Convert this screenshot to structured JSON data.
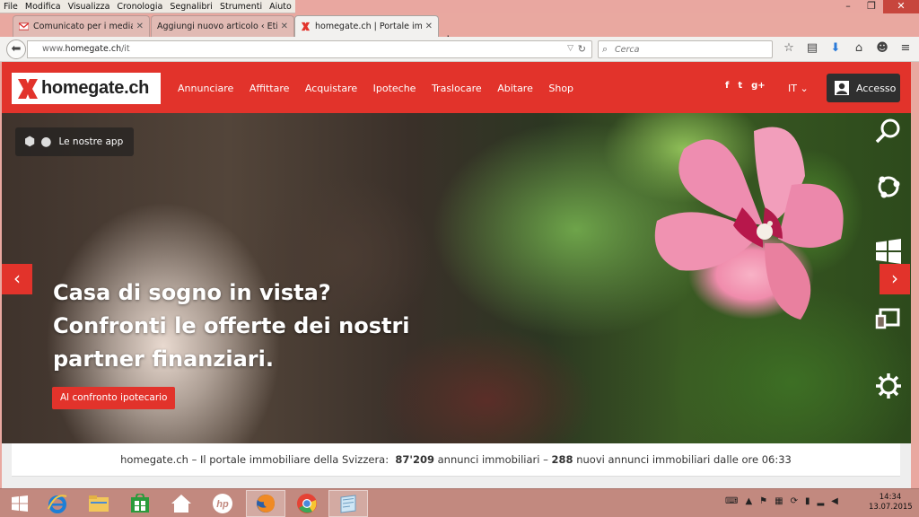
{
  "menubar": {
    "items": [
      "File",
      "Modifica",
      "Visualizza",
      "Cronologia",
      "Segnalibri",
      "Strumenti",
      "Aiuto"
    ]
  },
  "window_controls": {
    "minimize": "–",
    "restore": "❐",
    "close": "✕"
  },
  "tabs": [
    {
      "label": "Comunicato per i media: Il ...",
      "icon": "gmail-icon"
    },
    {
      "label": "Aggiungi nuovo articolo ‹ Etici...",
      "icon": "wordpress-icon"
    },
    {
      "label": "homegate.ch | Portale im...",
      "icon": "homegate-icon",
      "active": true
    }
  ],
  "new_tab": "+",
  "address_bar": {
    "prefix": "www.",
    "host": "homegate.ch",
    "path": "/it"
  },
  "search_bar": {
    "placeholder": "Cerca"
  },
  "site": {
    "logo_text": "homegate.ch",
    "nav": [
      "Annunciare",
      "Affittare",
      "Acquistare",
      "Ipoteche",
      "Traslocare",
      "Abitare",
      "Shop"
    ],
    "social": [
      "f",
      "t",
      "g+"
    ],
    "language": "IT",
    "login_label": "Accesso",
    "apps_label": "Le nostre app",
    "headline": [
      "Casa di sogno in vista?",
      "Confronti le offerte dei nostri",
      "partner finanziari."
    ],
    "cta_label": "Al confronto ipotecario",
    "info": {
      "prefix": "homegate.ch – Il portale immobiliare della Svizzera:",
      "count_total": "87'209",
      "mid": "annunci immobiliari –",
      "count_new": "288",
      "suffix": "nuovi annunci immobiliari dalle ore 06:33"
    },
    "brand_color": "#e2332b"
  },
  "taskbar": {
    "apps": [
      "windows-start",
      "internet-explorer",
      "file-explorer",
      "store",
      "home",
      "hp",
      "firefox",
      "chrome",
      "notes"
    ],
    "clock_time": "14:34",
    "clock_date": "13.07.2015"
  }
}
